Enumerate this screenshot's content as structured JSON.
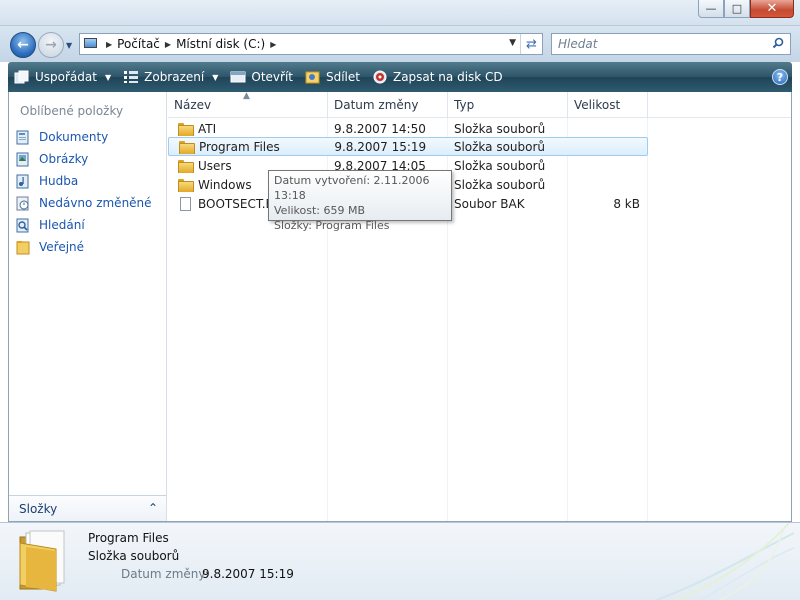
{
  "window": {
    "minimize_icon": "minimize-icon",
    "maximize_icon": "maximize-icon",
    "close_icon": "close-icon"
  },
  "address": {
    "crumbs": [
      "Počítač",
      "Místní disk (C:)"
    ],
    "search_placeholder": "Hledat"
  },
  "toolbar": {
    "organize": "Uspořádat",
    "views": "Zobrazení",
    "open": "Otevřít",
    "share": "Sdílet",
    "burn": "Zapsat na disk CD",
    "help": "?"
  },
  "nav": {
    "favorites_title": "Oblíbené položky",
    "favorites": [
      {
        "label": "Dokumenty",
        "icon": "documents-icon"
      },
      {
        "label": "Obrázky",
        "icon": "pictures-icon"
      },
      {
        "label": "Hudba",
        "icon": "music-icon"
      },
      {
        "label": "Nedávno změněné",
        "icon": "recent-icon"
      },
      {
        "label": "Hledání",
        "icon": "search-folder-icon"
      },
      {
        "label": "Veřejné",
        "icon": "public-folder-icon"
      }
    ],
    "folders_label": "Složky"
  },
  "columns": {
    "name": "Název",
    "date": "Datum změny",
    "type": "Typ",
    "size": "Velikost"
  },
  "files": [
    {
      "name": "ATI",
      "date": "9.8.2007 14:50",
      "type": "Složka souborů",
      "size": "",
      "kind": "folder"
    },
    {
      "name": "Program Files",
      "date": "9.8.2007 15:19",
      "type": "Složka souborů",
      "size": "",
      "kind": "folder"
    },
    {
      "name": "Users",
      "date": "9.8.2007 14:05",
      "type": "Složka souborů",
      "size": "",
      "kind": "folder"
    },
    {
      "name": "Windows",
      "date": "",
      "type": "Složka souborů",
      "size": "",
      "kind": "folder"
    },
    {
      "name": "BOOTSECT.BAK",
      "date": "",
      "type": "Soubor BAK",
      "size": "8 kB",
      "kind": "file"
    }
  ],
  "tooltip": {
    "line1": "Datum vytvoření: 2.11.2006 13:18",
    "line2": "Velikost: 659 MB",
    "line3": "Složky: Program Files"
  },
  "details": {
    "name": "Program Files",
    "type": "Složka souborů",
    "date_label": "Datum změny:",
    "date_value": "9.8.2007 15:19"
  },
  "colors": {
    "toolbar": "#2d5468",
    "link": "#1a56b0",
    "selection": "#dbeefc"
  }
}
